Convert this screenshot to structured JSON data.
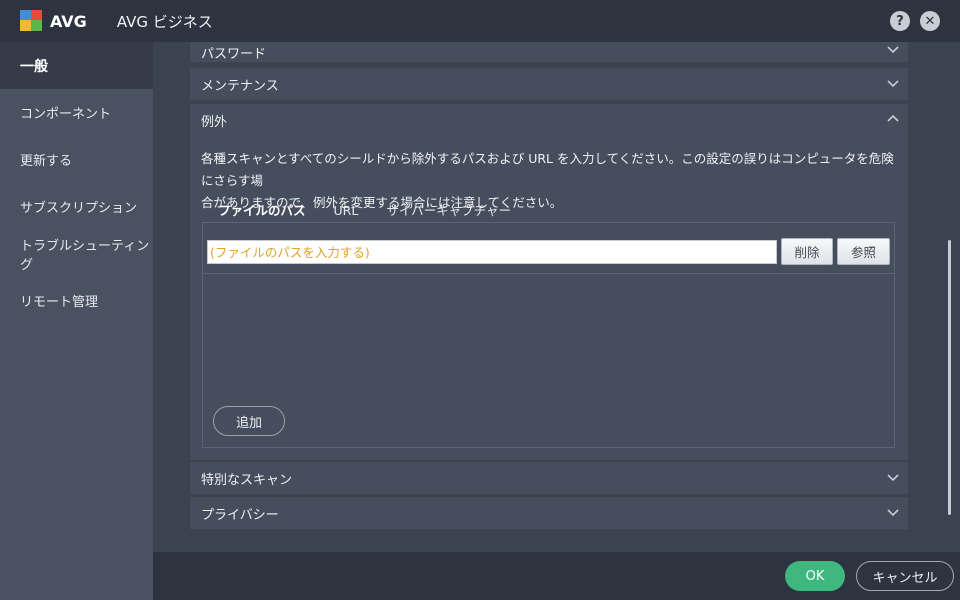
{
  "app": {
    "brand": "AVG",
    "title": "AVG ビジネス",
    "help_label": "?",
    "close_label": "✕"
  },
  "sidebar": {
    "items": [
      {
        "label": "一般",
        "active": true
      },
      {
        "label": "コンポーネント"
      },
      {
        "label": "更新する"
      },
      {
        "label": "サブスクリプション"
      },
      {
        "label": "トラブルシューティング"
      },
      {
        "label": "リモート管理"
      }
    ]
  },
  "sections": {
    "password": "パスワード",
    "maintenance": "メンテナンス",
    "exceptions": "例外",
    "special_scan": "特別なスキャン",
    "privacy": "プライバシー"
  },
  "exceptions": {
    "description_line1": "各種スキャンとすべてのシールドから除外するパスおよび URL を入力してください。この設定の誤りはコンピュータを危険にさらす場",
    "description_line2": "合がありますので、例外を変更する場合には注意してください。",
    "tabs": [
      "ファイルのパス",
      "URL",
      "サイバーキャプチャー"
    ],
    "input_placeholder": "(ファイルのパスを入力する)",
    "delete_label": "削除",
    "browse_label": "参照",
    "add_label": "追加"
  },
  "footer": {
    "ok_label": "OK",
    "cancel_label": "キャンセル"
  },
  "colors": {
    "accent_green": "#3fb87f",
    "placeholder_orange": "#e2a22a"
  }
}
